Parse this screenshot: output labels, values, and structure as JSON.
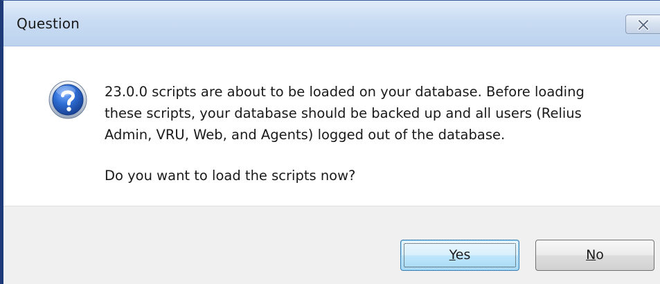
{
  "window": {
    "title": "Question",
    "close_icon": "close-icon"
  },
  "message": {
    "icon": "question-icon",
    "lines": [
      "23.0.0 scripts are about to be loaded on your database. Before loading",
      "these scripts, your database should be backed up and all users (Relius",
      "Admin, VRU, Web, and Agents) logged out of the database."
    ],
    "prompt": "Do you want to load the scripts now?"
  },
  "buttons": {
    "yes": {
      "accel": "Y",
      "rest": "es"
    },
    "no": {
      "accel": "N",
      "rest": "o"
    }
  },
  "colors": {
    "titlebar": "#c9dcf3",
    "footer": "#f0f0f0",
    "icon_blue": "#2a5bb8"
  }
}
